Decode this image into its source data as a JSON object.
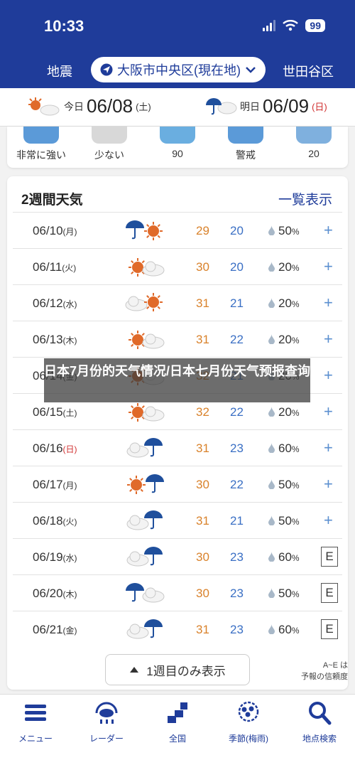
{
  "status": {
    "time": "10:33",
    "battery": "99"
  },
  "nav": {
    "left": "地震",
    "location": "大阪市中央区(現在地)",
    "right": "世田谷区"
  },
  "days": [
    {
      "label": "今日",
      "date": "06/08",
      "dow": "(土)",
      "dow_color": "#333333"
    },
    {
      "label": "明日",
      "date": "06/09",
      "dow": "(日)",
      "dow_color": "#d03030"
    }
  ],
  "indices": [
    {
      "icon": "glasses-icon",
      "value": "非常に強い"
    },
    {
      "icon": "pollen-icon",
      "value": "少ない"
    },
    {
      "icon": "shirt-icon",
      "value": "90"
    },
    {
      "icon": "heat-face-icon",
      "value": "警戒"
    },
    {
      "icon": "umbrella-icon",
      "value": "20"
    }
  ],
  "forecast": {
    "title": "2週間天気",
    "list_link": "一覧表示",
    "rows": [
      {
        "date": "06/10",
        "dow": "(月)",
        "dow_color": "#333333",
        "icon": "rain-then-sun",
        "high": "29",
        "low": "20",
        "pop": "50",
        "unit": "%",
        "action": "+"
      },
      {
        "date": "06/11",
        "dow": "(火)",
        "dow_color": "#333333",
        "icon": "sun-cloud",
        "high": "30",
        "low": "20",
        "pop": "20",
        "unit": "%",
        "action": "+"
      },
      {
        "date": "06/12",
        "dow": "(水)",
        "dow_color": "#333333",
        "icon": "cloud-then-sun",
        "high": "31",
        "low": "21",
        "pop": "20",
        "unit": "%",
        "action": "+"
      },
      {
        "date": "06/13",
        "dow": "(木)",
        "dow_color": "#333333",
        "icon": "sun-cloud",
        "high": "31",
        "low": "22",
        "pop": "20",
        "unit": "%",
        "action": "+"
      },
      {
        "date": "06/14",
        "dow": "(金)",
        "dow_color": "#333333",
        "icon": "sun-cloud",
        "high": "32",
        "low": "21",
        "pop": "20",
        "unit": "%",
        "action": "+"
      },
      {
        "date": "06/15",
        "dow": "(土)",
        "dow_color": "#333333",
        "icon": "sun-cloud",
        "high": "32",
        "low": "22",
        "pop": "20",
        "unit": "%",
        "action": "+"
      },
      {
        "date": "06/16",
        "dow": "(日)",
        "dow_color": "#d03030",
        "icon": "cloud-rain",
        "high": "31",
        "low": "23",
        "pop": "60",
        "unit": "%",
        "action": "+"
      },
      {
        "date": "06/17",
        "dow": "(月)",
        "dow_color": "#333333",
        "icon": "sun-rain",
        "high": "30",
        "low": "22",
        "pop": "50",
        "unit": "%",
        "action": "+"
      },
      {
        "date": "06/18",
        "dow": "(火)",
        "dow_color": "#333333",
        "icon": "cloud-rain",
        "high": "31",
        "low": "21",
        "pop": "50",
        "unit": "%",
        "action": "+"
      },
      {
        "date": "06/19",
        "dow": "(水)",
        "dow_color": "#333333",
        "icon": "cloud-rain",
        "high": "30",
        "low": "23",
        "pop": "60",
        "unit": "%",
        "action": "E"
      },
      {
        "date": "06/20",
        "dow": "(木)",
        "dow_color": "#333333",
        "icon": "rain-cloud",
        "high": "30",
        "low": "23",
        "pop": "50",
        "unit": "%",
        "action": "E"
      },
      {
        "date": "06/21",
        "dow": "(金)",
        "dow_color": "#333333",
        "icon": "cloud-rain",
        "high": "31",
        "low": "23",
        "pop": "60",
        "unit": "%",
        "action": "E"
      }
    ],
    "week_button": "1週目のみ表示",
    "reliability_line1": "A~E は",
    "reliability_line2": "予報の信頼度"
  },
  "tabs": [
    {
      "icon": "menu-icon",
      "label": "メニュー"
    },
    {
      "icon": "radar-icon",
      "label": "レーダー"
    },
    {
      "icon": "japan-map-icon",
      "label": "全国"
    },
    {
      "icon": "hydrangea-icon",
      "label": "季節(梅雨)"
    },
    {
      "icon": "search-icon",
      "label": "地点検索"
    }
  ],
  "overlay_text": "日本7月份的天气情况/日本七月份天气预报查询",
  "colors": {
    "brand": "#1f3c9a",
    "high": "#d9822b",
    "low": "#3a6fc4",
    "sun": "#e06a2a",
    "umbrella": "#1f4f9c"
  }
}
